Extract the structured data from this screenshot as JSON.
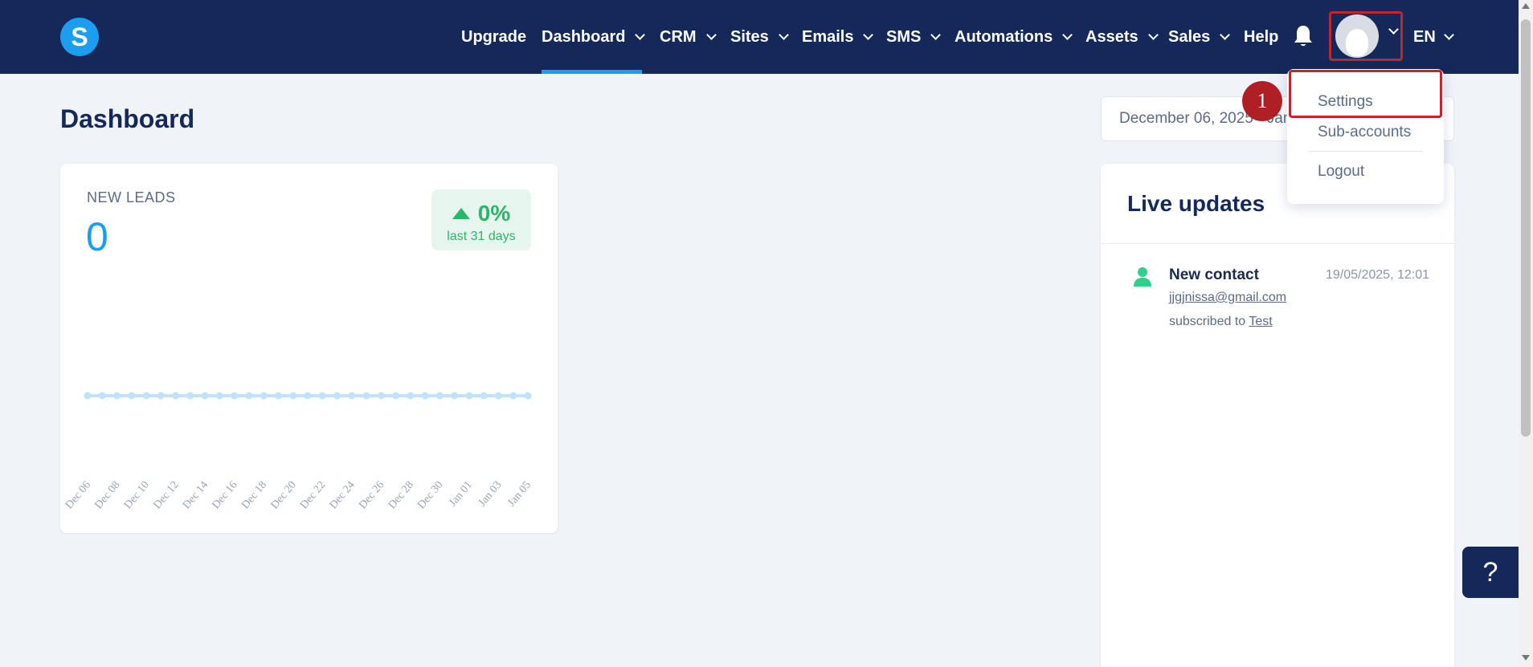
{
  "app": {
    "logo_letter": "S"
  },
  "nav": {
    "items": [
      {
        "label": "Upgrade",
        "dropdown": false
      },
      {
        "label": "Dashboard",
        "dropdown": true,
        "active": true
      },
      {
        "label": "CRM",
        "dropdown": true
      },
      {
        "label": "Sites",
        "dropdown": true
      },
      {
        "label": "Emails",
        "dropdown": true
      },
      {
        "label": "SMS",
        "dropdown": true
      },
      {
        "label": "Automations",
        "dropdown": true
      },
      {
        "label": "Assets",
        "dropdown": true
      },
      {
        "label": "Sales",
        "dropdown": true
      },
      {
        "label": "Help",
        "dropdown": false
      }
    ],
    "language": "EN"
  },
  "page": {
    "title": "Dashboard",
    "date_range": "December 06, 2025 - Jan"
  },
  "leads_card": {
    "label": "NEW LEADS",
    "value": "0",
    "change_value": "0%",
    "change_period": "last 31 days"
  },
  "chart_data": {
    "type": "line",
    "categories": [
      "Dec 06",
      "Dec 08",
      "Dec 10",
      "Dec 12",
      "Dec 14",
      "Dec 16",
      "Dec 18",
      "Dec 20",
      "Dec 22",
      "Dec 24",
      "Dec 26",
      "Dec 28",
      "Dec 30",
      "Jan 01",
      "Jan 03",
      "Jan 05"
    ],
    "point_count": 31,
    "values": [
      0,
      0,
      0,
      0,
      0,
      0,
      0,
      0,
      0,
      0,
      0,
      0,
      0,
      0,
      0,
      0,
      0,
      0,
      0,
      0,
      0,
      0,
      0,
      0,
      0,
      0,
      0,
      0,
      0,
      0,
      0
    ],
    "title": "",
    "xlabel": "",
    "ylabel": "",
    "color": "#bfe3fb",
    "grid": false
  },
  "live_updates": {
    "title": "Live updates",
    "items": [
      {
        "title": "New contact",
        "time": "19/05/2025, 12:01",
        "email": "jjgjnissa@gmail.com",
        "subscribed_prefix": "subscribed to",
        "list_name": "Test"
      }
    ]
  },
  "user_menu": {
    "items": [
      "Settings",
      "Sub-accounts",
      "Logout"
    ]
  },
  "annotation": {
    "step": "1"
  },
  "help_button": {
    "label": "?"
  },
  "colors": {
    "nav_bg": "#14285a",
    "accent": "#1c9ef0",
    "positive": "#2ab56a",
    "highlight": "#c0262c"
  }
}
